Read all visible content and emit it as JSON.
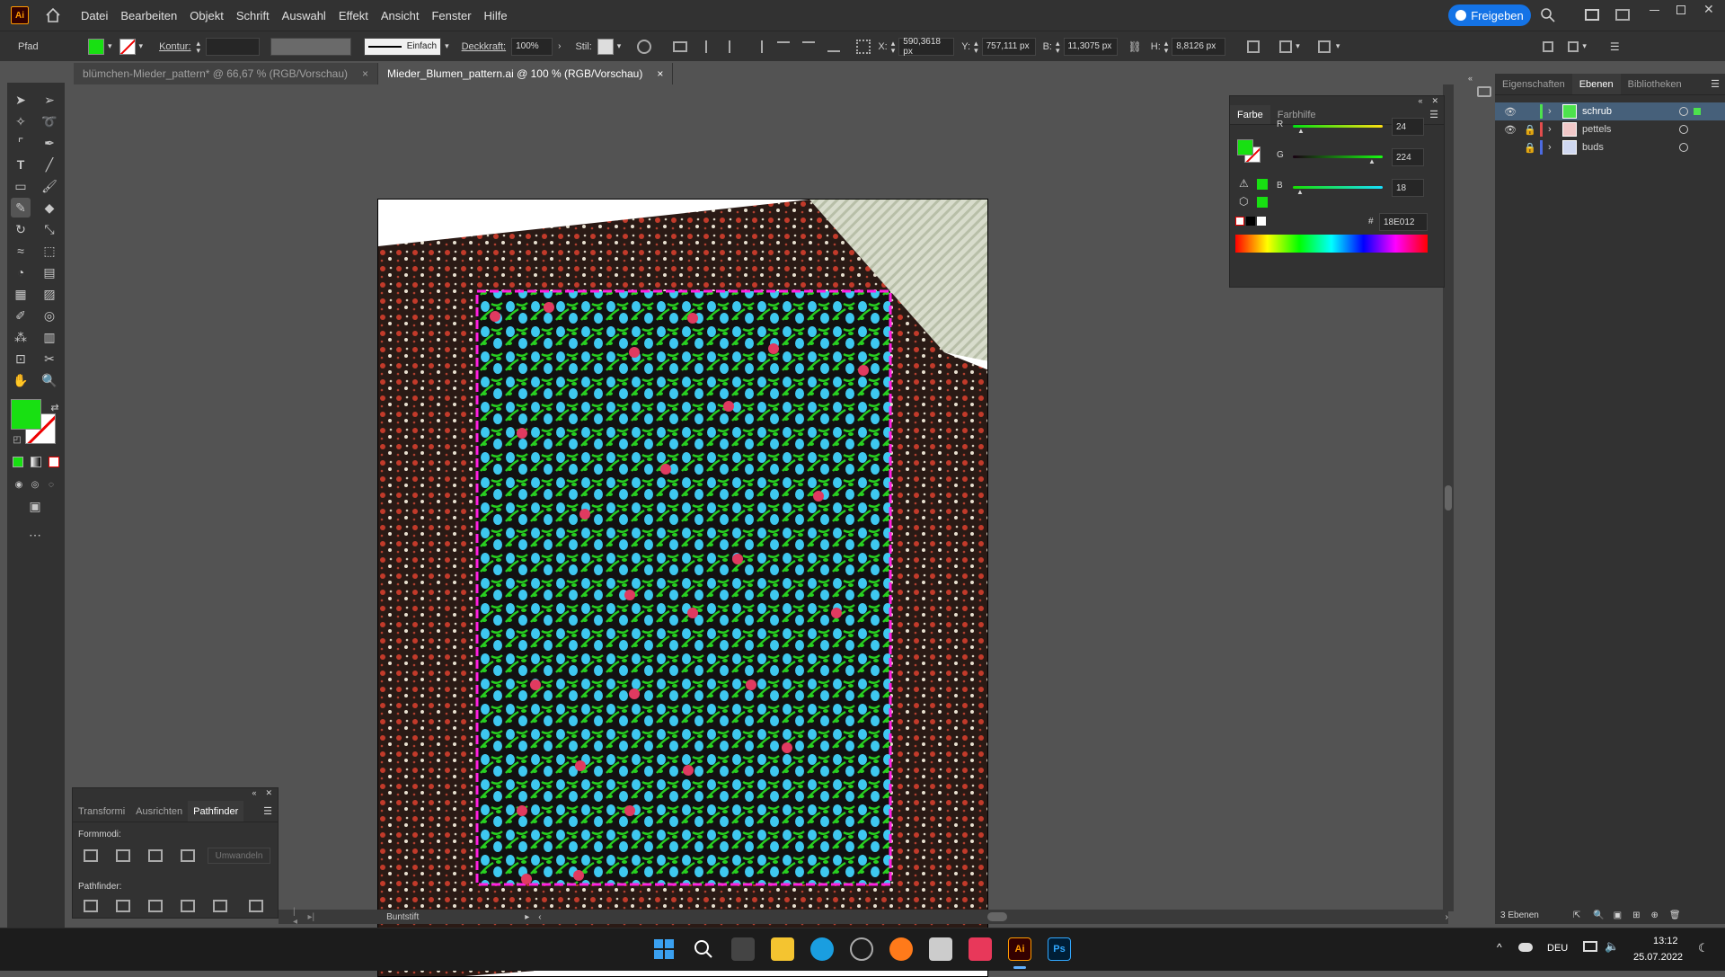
{
  "menubar": {
    "app_logo": "Ai",
    "items": [
      "Datei",
      "Bearbeiten",
      "Objekt",
      "Schrift",
      "Auswahl",
      "Effekt",
      "Ansicht",
      "Fenster",
      "Hilfe"
    ],
    "share_label": "Freigeben"
  },
  "controlbar": {
    "object_type": "Pfad",
    "fill_color": "#18E012",
    "stroke_label": "Kontur:",
    "stroke_style": "Einfach",
    "opacity_label": "Deckkraft:",
    "opacity_value": "100%",
    "style_label": "Stil:",
    "x_label": "X:",
    "x_value": "590,3618 px",
    "y_label": "Y:",
    "y_value": "757,111 px",
    "w_label": "B:",
    "w_value": "11,3075 px",
    "h_label": "H:",
    "h_value": "8,8126 px"
  },
  "tabs": [
    {
      "label": "blümchen-Mieder_pattern* @ 66,67 % (RGB/Vorschau)",
      "active": false
    },
    {
      "label": "Mieder_Blumen_pattern.ai @ 100 % (RGB/Vorschau)",
      "active": true
    }
  ],
  "tabs_close": "×",
  "pathfinder": {
    "tabs": [
      "Transformi",
      "Ausrichten",
      "Pathfinder"
    ],
    "shape_modes_label": "Formmodi:",
    "expand_label": "Umwandeln",
    "pathfinders_label": "Pathfinder:"
  },
  "farbe": {
    "tabs": [
      "Farbe",
      "Farbhilfe"
    ],
    "r_label": "R",
    "r_value": "24",
    "g_label": "G",
    "g_value": "224",
    "b_label": "B",
    "b_value": "18",
    "hex_label": "#",
    "hex_value": "18E012"
  },
  "layers_panel": {
    "tabs": [
      "Eigenschaften",
      "Ebenen",
      "Bibliotheken"
    ],
    "layers": [
      {
        "name": "schrub",
        "color": "#4de24d",
        "visible": true,
        "locked": false,
        "selected": true
      },
      {
        "name": "pettels",
        "color": "#e24d4d",
        "visible": true,
        "locked": true,
        "selected": false
      },
      {
        "name": "buds",
        "color": "#4d6be2",
        "visible": false,
        "locked": true,
        "selected": false
      }
    ],
    "count_label": "3 Ebenen"
  },
  "statusbar": {
    "tool_name": "Buntstift"
  },
  "taskbar": {
    "language": "DEU",
    "time": "13:12",
    "date": "25.07.2022",
    "ai_label": "Ai",
    "ps_label": "Ps"
  }
}
